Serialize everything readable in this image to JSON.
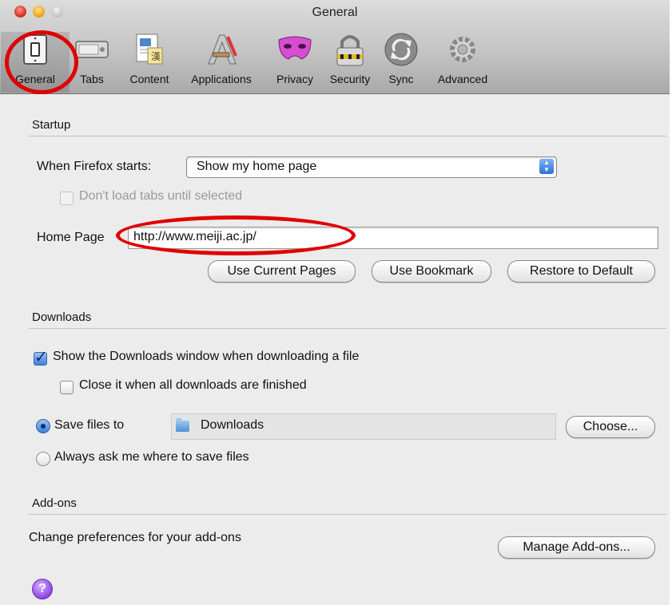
{
  "window": {
    "title": "General"
  },
  "toolbar": {
    "items": [
      {
        "label": "General",
        "icon": "light-switch-icon",
        "selected": true
      },
      {
        "label": "Tabs",
        "icon": "tabs-icon"
      },
      {
        "label": "Content",
        "icon": "document-icon"
      },
      {
        "label": "Applications",
        "icon": "applications-icon"
      },
      {
        "label": "Privacy",
        "icon": "mask-icon"
      },
      {
        "label": "Security",
        "icon": "padlock-icon"
      },
      {
        "label": "Sync",
        "icon": "sync-icon"
      },
      {
        "label": "Advanced",
        "icon": "gear-icon"
      }
    ]
  },
  "startup": {
    "title": "Startup",
    "when_label": "When Firefox starts:",
    "when_value": "Show my home page",
    "dont_load_label": "Don't load tabs until selected",
    "home_label": "Home Page",
    "home_value": "http://www.meiji.ac.jp/",
    "use_current": "Use Current Pages",
    "use_bookmark": "Use Bookmark",
    "restore_default": "Restore to Default"
  },
  "downloads": {
    "title": "Downloads",
    "show_window_label": "Show the Downloads window when downloading a file",
    "show_window_checked": true,
    "close_label": "Close it when all downloads are finished",
    "close_checked": false,
    "save_to_label": "Save files to",
    "save_path": "Downloads",
    "choose_button": "Choose...",
    "always_ask_label": "Always ask me where to save files",
    "selected_option": "save_to"
  },
  "addons": {
    "title": "Add-ons",
    "description": "Change preferences for your add-ons",
    "manage_button": "Manage Add-ons..."
  },
  "help": {
    "symbol": "?"
  },
  "colors": {
    "annotation": "#e00000",
    "accent": "#3c7ee0"
  }
}
